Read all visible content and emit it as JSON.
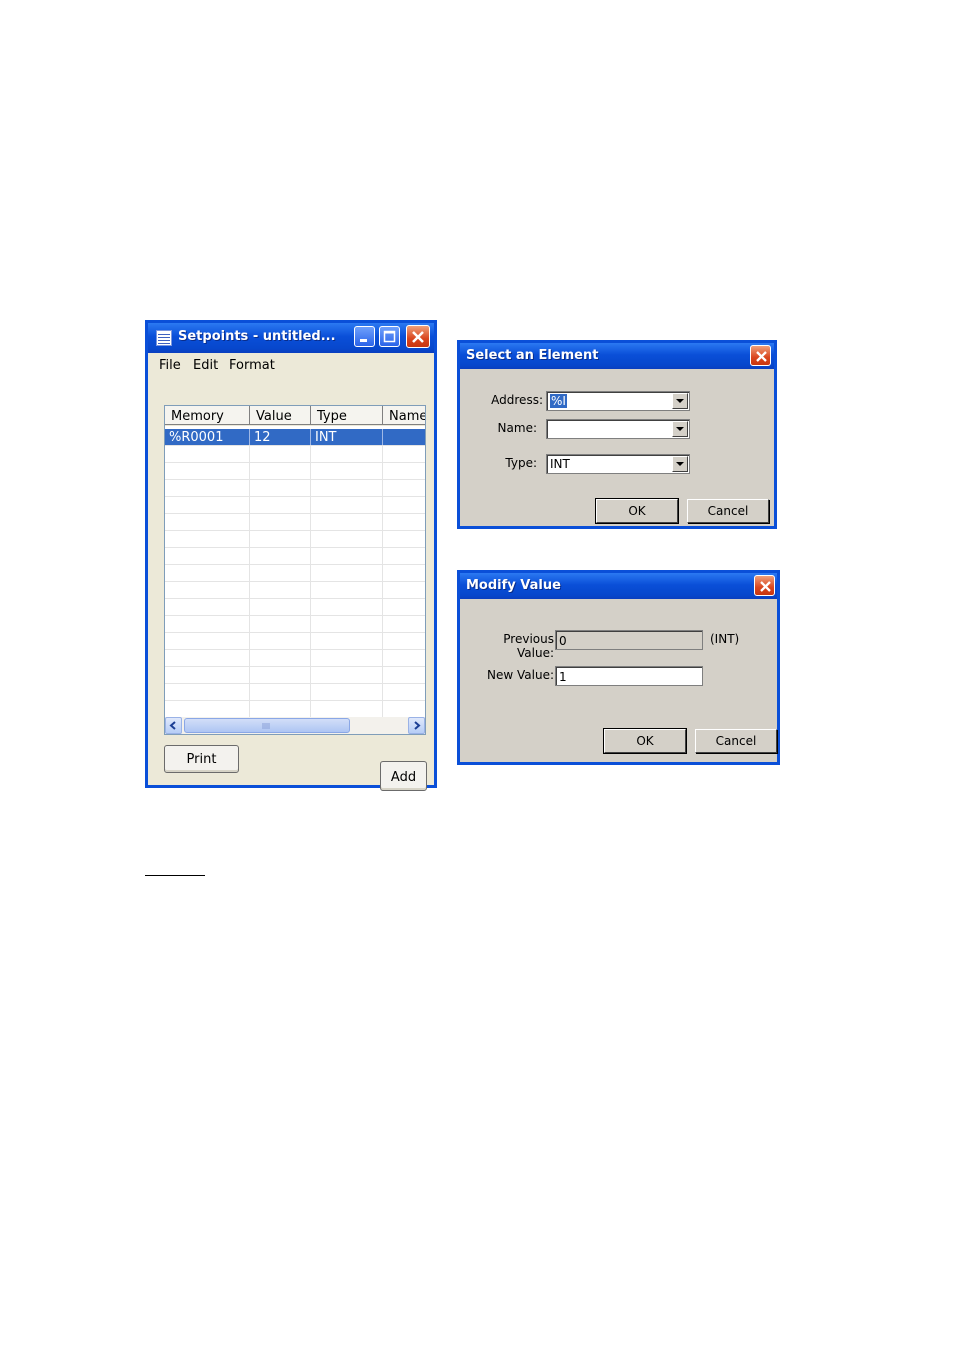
{
  "setpoints_window": {
    "title": "Setpoints - untitled...",
    "menu": [
      "File",
      "Edit",
      "Format"
    ],
    "columns": [
      "Memory",
      "Value",
      "Type",
      "Name"
    ],
    "rows": [
      {
        "memory": "%R0001",
        "value": "12",
        "type": "INT",
        "name": ""
      }
    ],
    "print_label": "Print",
    "add_label": "Add"
  },
  "select_element_dialog": {
    "title": "Select an Element",
    "address_label": "Address:",
    "address_value": "%I",
    "name_label": "Name:",
    "name_value": "",
    "type_label": "Type:",
    "type_value": "INT",
    "ok_label": "OK",
    "cancel_label": "Cancel"
  },
  "modify_value_dialog": {
    "title": "Modify Value",
    "previous_label": "Previous Value:",
    "previous_value": "0",
    "type_hint": "(INT)",
    "new_label": "New Value:",
    "new_value": "1",
    "ok_label": "OK",
    "cancel_label": "Cancel"
  },
  "colors": {
    "xp_title_blue": "#0a4fd8",
    "selection_blue": "#316ac5",
    "close_red": "#d9461f",
    "dialog_gray": "#d4d0c8"
  }
}
